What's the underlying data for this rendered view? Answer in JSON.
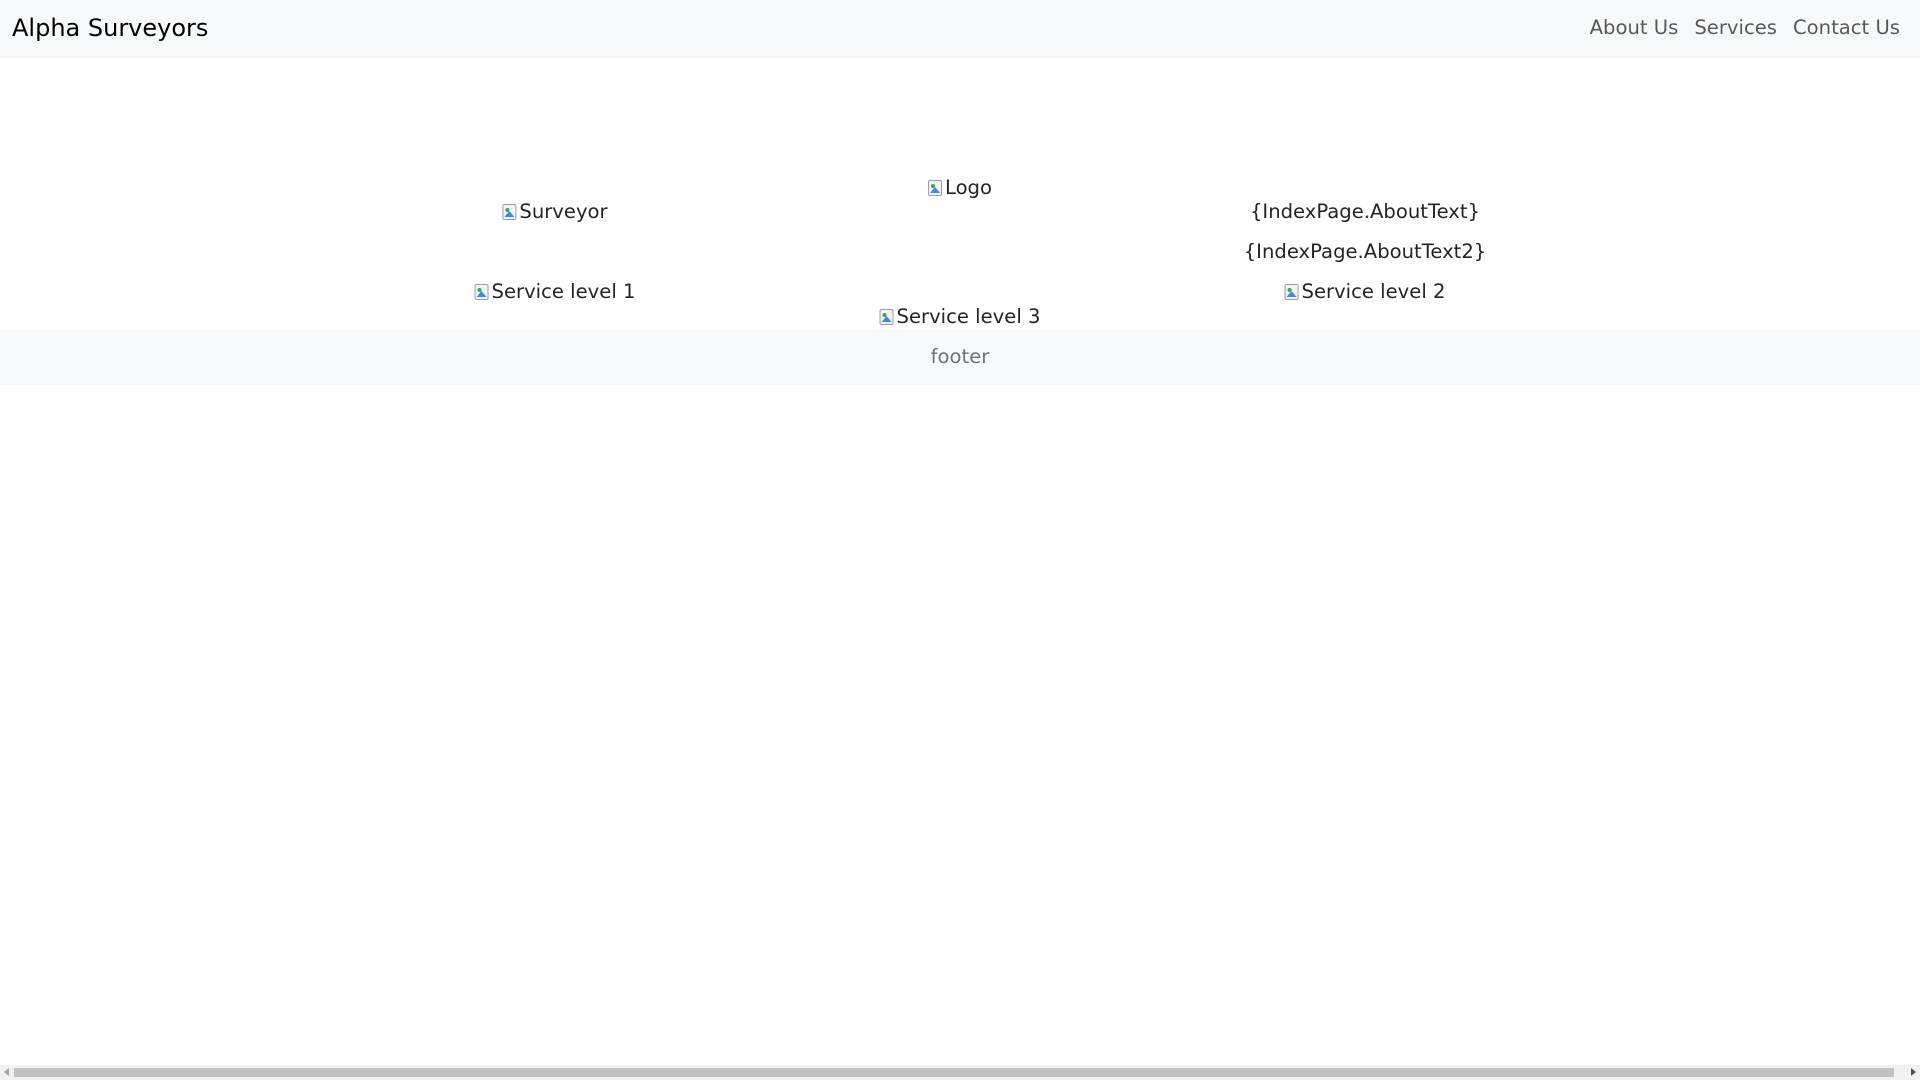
{
  "navbar": {
    "brand": "Alpha Surveyors",
    "links": [
      "About Us",
      "Services",
      "Contact Us"
    ]
  },
  "main": {
    "logo_alt": "Logo",
    "surveyor_alt": "Surveyor",
    "about_text": "{IndexPage.AboutText}",
    "about_text2": "{IndexPage.AboutText2}",
    "service1_alt": "Service level 1",
    "service2_alt": "Service level 2",
    "service3_alt": "Service level 3"
  },
  "footer": {
    "text": "footer"
  },
  "icons": {
    "broken_image": "broken-image-icon"
  }
}
